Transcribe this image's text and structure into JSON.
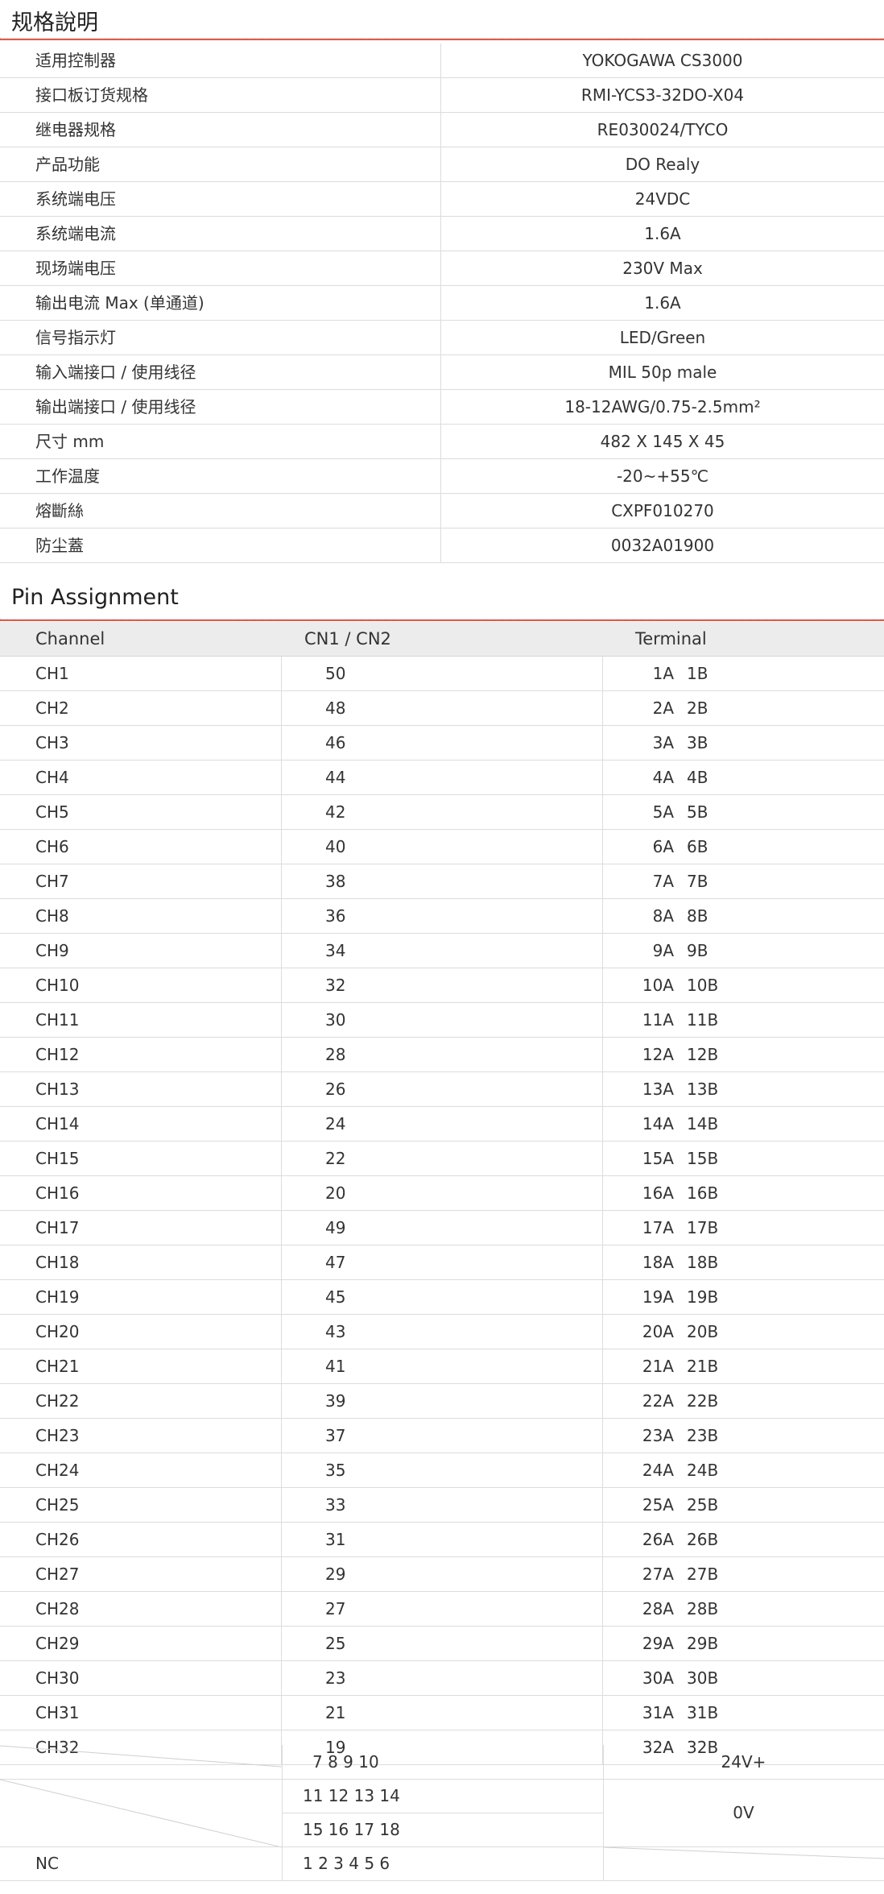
{
  "spec_section": {
    "title": "规格說明",
    "rows": [
      {
        "label": "适用控制器",
        "value": "YOKOGAWA  CS3000"
      },
      {
        "label": "接口板订货规格",
        "value": "RMI-YCS3-32DO-X04"
      },
      {
        "label": "继电器规格",
        "value": "RE030024/TYCO"
      },
      {
        "label": "产品功能",
        "value": "DO Realy"
      },
      {
        "label": "系统端电压",
        "value": "24VDC"
      },
      {
        "label": "系统端电流",
        "value": "1.6A"
      },
      {
        "label": "现场端电压",
        "value": "230V  Max"
      },
      {
        "label": "输出电流 Max (单通道)",
        "value": "1.6A"
      },
      {
        "label": "信号指示灯",
        "value": "LED/Green"
      },
      {
        "label": "输入端接口 / 使用线径",
        "value": "MIL  50p   male"
      },
      {
        "label": "输出端接口 / 使用线径",
        "value": "18-12AWG/0.75-2.5mm²"
      },
      {
        "label": "尺寸 mm",
        "value": "482 X 145 X 45"
      },
      {
        "label": "工作温度",
        "value": "-20~+55℃"
      },
      {
        "label": "熔斷絲",
        "value": "CXPF010270"
      },
      {
        "label": "防尘蓋",
        "value": "0032A01900"
      }
    ]
  },
  "pin_section": {
    "title": "Pin Assignment",
    "headers": {
      "channel": "Channel",
      "cn": "CN1 / CN2",
      "terminal": "Terminal"
    },
    "rows": [
      {
        "ch": "CH1",
        "pin": "50",
        "ta": "1A",
        "tb": "1B"
      },
      {
        "ch": "CH2",
        "pin": "48",
        "ta": "2A",
        "tb": "2B"
      },
      {
        "ch": "CH3",
        "pin": "46",
        "ta": "3A",
        "tb": "3B"
      },
      {
        "ch": "CH4",
        "pin": "44",
        "ta": "4A",
        "tb": "4B"
      },
      {
        "ch": "CH5",
        "pin": "42",
        "ta": "5A",
        "tb": "5B"
      },
      {
        "ch": "CH6",
        "pin": "40",
        "ta": "6A",
        "tb": "6B"
      },
      {
        "ch": "CH7",
        "pin": "38",
        "ta": "7A",
        "tb": "7B"
      },
      {
        "ch": "CH8",
        "pin": "36",
        "ta": "8A",
        "tb": "8B"
      },
      {
        "ch": "CH9",
        "pin": "34",
        "ta": "9A",
        "tb": "9B"
      },
      {
        "ch": "CH10",
        "pin": "32",
        "ta": "10A",
        "tb": "10B"
      },
      {
        "ch": "CH11",
        "pin": "30",
        "ta": "11A",
        "tb": "11B"
      },
      {
        "ch": "CH12",
        "pin": "28",
        "ta": "12A",
        "tb": "12B"
      },
      {
        "ch": "CH13",
        "pin": "26",
        "ta": "13A",
        "tb": "13B"
      },
      {
        "ch": "CH14",
        "pin": "24",
        "ta": "14A",
        "tb": "14B"
      },
      {
        "ch": "CH15",
        "pin": "22",
        "ta": "15A",
        "tb": "15B"
      },
      {
        "ch": "CH16",
        "pin": "20",
        "ta": "16A",
        "tb": "16B"
      },
      {
        "ch": "CH17",
        "pin": "49",
        "ta": "17A",
        "tb": "17B"
      },
      {
        "ch": "CH18",
        "pin": "47",
        "ta": "18A",
        "tb": "18B"
      },
      {
        "ch": "CH19",
        "pin": "45",
        "ta": "19A",
        "tb": "19B"
      },
      {
        "ch": "CH20",
        "pin": "43",
        "ta": "20A",
        "tb": "20B"
      },
      {
        "ch": "CH21",
        "pin": "41",
        "ta": "21A",
        "tb": "21B"
      },
      {
        "ch": "CH22",
        "pin": "39",
        "ta": "22A",
        "tb": "22B"
      },
      {
        "ch": "CH23",
        "pin": "37",
        "ta": "23A",
        "tb": "23B"
      },
      {
        "ch": "CH24",
        "pin": "35",
        "ta": "24A",
        "tb": "24B"
      },
      {
        "ch": "CH25",
        "pin": "33",
        "ta": "25A",
        "tb": "25B"
      },
      {
        "ch": "CH26",
        "pin": "31",
        "ta": "26A",
        "tb": "26B"
      },
      {
        "ch": "CH27",
        "pin": "29",
        "ta": "27A",
        "tb": "27B"
      },
      {
        "ch": "CH28",
        "pin": "27",
        "ta": "28A",
        "tb": "28B"
      },
      {
        "ch": "CH29",
        "pin": "25",
        "ta": "29A",
        "tb": "29B"
      },
      {
        "ch": "CH30",
        "pin": "23",
        "ta": "30A",
        "tb": "30B"
      },
      {
        "ch": "CH31",
        "pin": "21",
        "ta": "31A",
        "tb": "31B"
      },
      {
        "ch": "CH32",
        "pin": "19",
        "ta": "32A",
        "tb": "32B"
      }
    ],
    "extra": {
      "pins_24v": "7  8  9  10",
      "label_24v": "24V+",
      "pins_0v_a": "11  12  13  14",
      "pins_0v_b": "15  16  17  18",
      "label_0v": "0V",
      "nc_label": "NC",
      "nc_pins": "1  2  3  4  5  6"
    }
  }
}
